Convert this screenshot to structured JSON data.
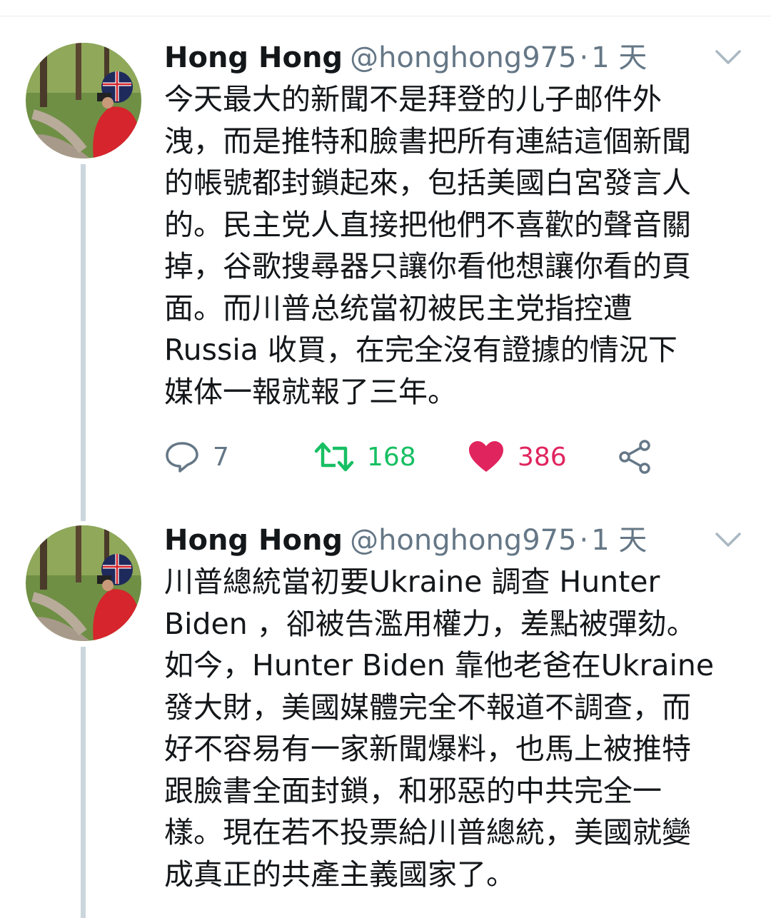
{
  "tweets": [
    {
      "name": "Hong Hong",
      "handle": "@honghong975",
      "separator": "·",
      "time": "1 天",
      "text": "今天最大的新聞不是拜登的儿子邮件外\n洩，而是推特和臉書把所有連結這個新聞\n的帳號都封鎖起來，包括美國白宮發言人\n的。民主党人直接把他們不喜歡的聲音關\n掉，谷歌搜尋器只讓你看他想讓你看的頁\n面。而川普总统當初被民主党指控遭\nRussia 收買，在完全沒有證據的情況下\n媒体一報就報了三年。",
      "replies": "7",
      "retweets": "168",
      "likes": "386"
    },
    {
      "name": "Hong Hong",
      "handle": "@honghong975",
      "separator": "·",
      "time": "1 天",
      "text": "川普總統當初要Ukraine 調查 Hunter\nBiden ，卻被告濫用權力，差點被彈劾。\n如今，Hunter Biden 靠他老爸在Ukraine\n發大財，美國媒體完全不報道不調查，而\n好不容易有一家新聞爆料，也馬上被推特\n跟臉書全面封鎖，和邪惡的中共完全一\n樣。現在若不投票給川普總統，美國就變\n成真正的共產主義國家了。"
    }
  ],
  "colors": {
    "text": "#14171a",
    "secondary": "#657786",
    "retweet": "#17bf63",
    "like": "#e0245e",
    "thread_line": "#ccd6dd"
  },
  "icons": [
    "reply-icon",
    "retweet-icon",
    "heart-icon",
    "share-icon",
    "chevron-down-icon"
  ]
}
